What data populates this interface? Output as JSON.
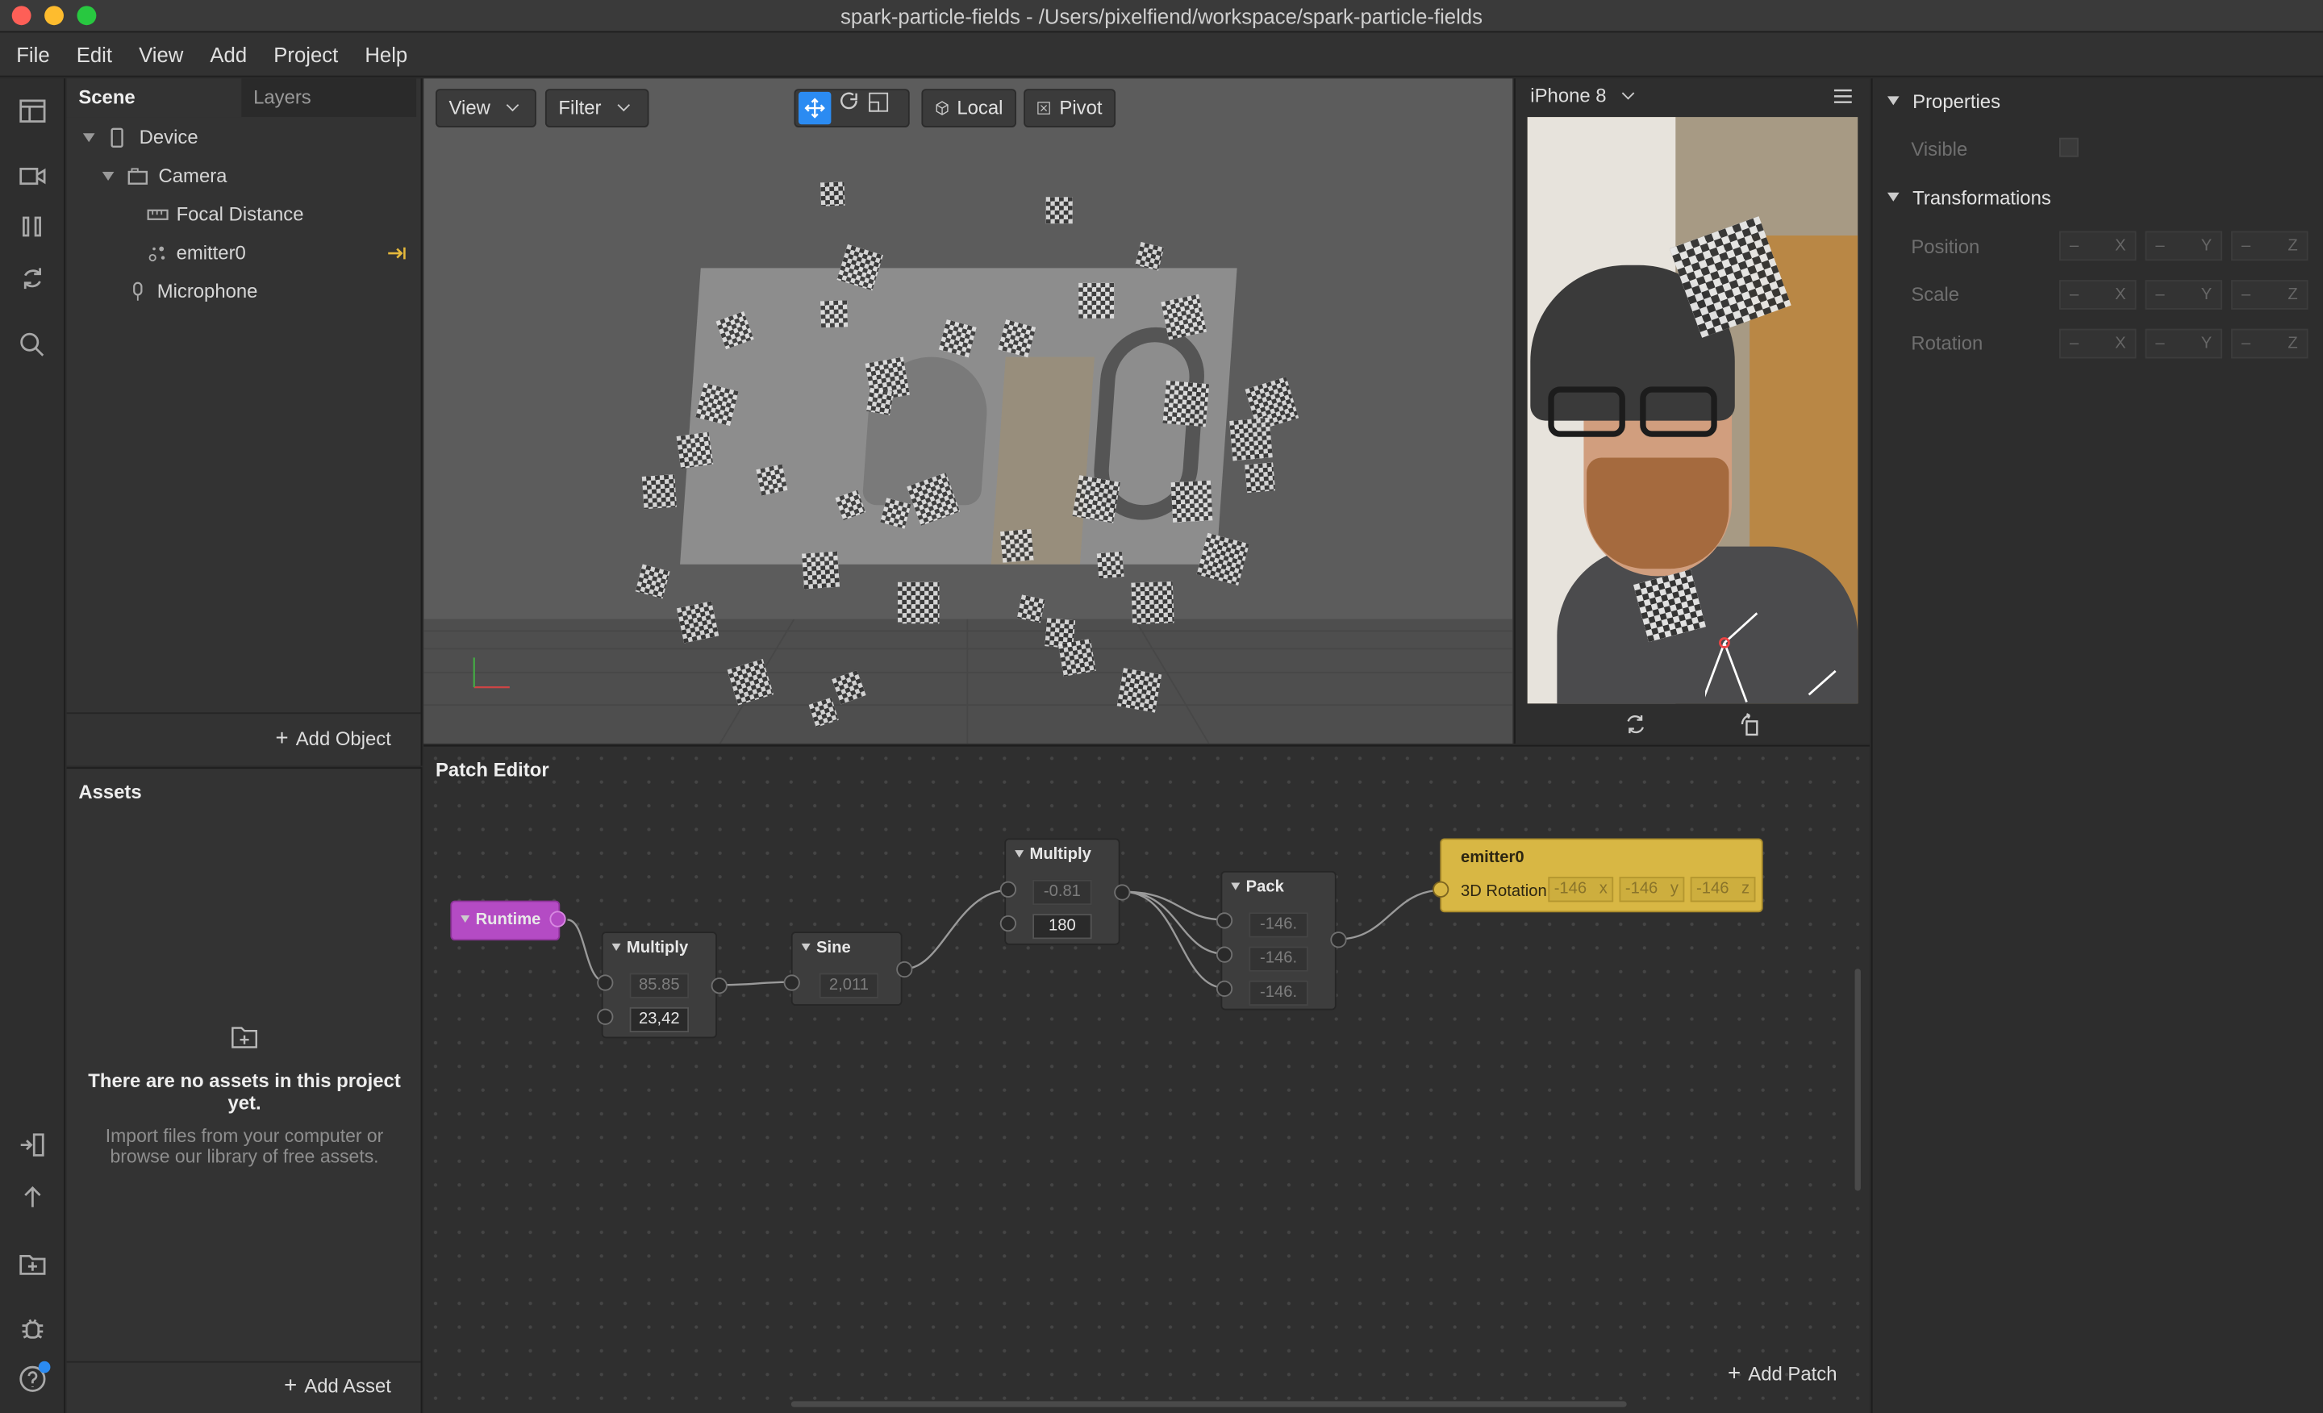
{
  "window": {
    "title": "spark-particle-fields - /Users/pixelfiend/workspace/spark-particle-fields"
  },
  "menu": [
    "File",
    "Edit",
    "View",
    "Add",
    "Project",
    "Help"
  ],
  "scene": {
    "tabs": [
      "Scene",
      "Layers"
    ],
    "tree": [
      {
        "label": "Device",
        "icon": "phone-icon"
      },
      {
        "label": "Camera",
        "icon": "camera-icon"
      },
      {
        "label": "Focal Distance",
        "icon": "ruler-icon"
      },
      {
        "label": "emitter0",
        "icon": "particle-emitter-icon"
      },
      {
        "label": "Microphone",
        "icon": "microphone-icon"
      }
    ],
    "add_object": "Add Object"
  },
  "assets": {
    "title": "Assets",
    "empty_title": "There are no assets in this project yet.",
    "empty_text": "Import files from your computer or browse our library of free assets.",
    "add_asset": "Add Asset"
  },
  "viewport": {
    "view_label": "View",
    "filter_label": "Filter",
    "local_label": "Local",
    "pivot_label": "Pivot"
  },
  "device": {
    "name": "iPhone 8"
  },
  "patch_editor": {
    "title": "Patch Editor",
    "add_patch": "Add Patch",
    "nodes": {
      "runtime": {
        "title": "Runtime"
      },
      "multiply1": {
        "title": "Multiply",
        "in1": "85.85",
        "in2": "23,42"
      },
      "sine": {
        "title": "Sine",
        "in1": "2,011"
      },
      "multiply2": {
        "title": "Multiply",
        "in1": "-0.81",
        "in2": "180"
      },
      "pack": {
        "title": "Pack",
        "in1": "-146.",
        "in2": "-146.",
        "in3": "-146."
      },
      "emitter": {
        "title": "emitter0",
        "port_label": "3D Rotation",
        "x": "-146",
        "y": "-146",
        "z": "-146",
        "xl": "x",
        "yl": "y",
        "zl": "z"
      }
    }
  },
  "properties": {
    "section1": "Properties",
    "visible_label": "Visible",
    "section2": "Transformations",
    "rows": [
      {
        "label": "Position",
        "x": "–",
        "y": "–",
        "z": "–"
      },
      {
        "label": "Scale",
        "x": "–",
        "y": "–",
        "z": "–"
      },
      {
        "label": "Rotation",
        "x": "–",
        "y": "–",
        "z": "–"
      }
    ],
    "axis": {
      "x": "X",
      "y": "Y",
      "z": "Z"
    }
  },
  "colors": {
    "runtime": "#b44bc4",
    "emitter": "#d8b744",
    "accent": "#2b8bf2"
  }
}
